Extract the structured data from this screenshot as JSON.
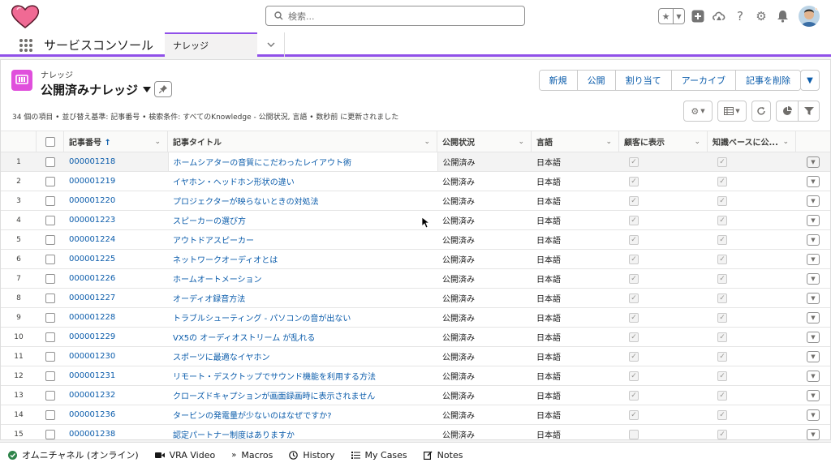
{
  "header": {
    "search_placeholder": "検索...",
    "app_name": "サービスコンソール",
    "tab_label": "ナレッジ"
  },
  "list": {
    "object_label": "ナレッジ",
    "list_name": "公開済みナレッジ",
    "status_text": "34 個の項目 • 並び替え基準: 記事番号 • 検索条件: すべてのKnowledge - 公開状況, 言語 • 数秒前 に更新されました",
    "actions": [
      "新規",
      "公開",
      "割り当て",
      "アーカイブ",
      "記事を削除"
    ]
  },
  "columns": {
    "article_number": "記事番号",
    "title": "記事タイトル",
    "publish_status": "公開状況",
    "language": "言語",
    "visible_to_customer": "顧客に表示",
    "knowledge_base": "知識ベースに公..."
  },
  "rows": [
    {
      "n": "1",
      "id": "000001218",
      "title": "ホームシアターの音質にこだわったレイアウト術",
      "status": "公開済み",
      "lang": "日本語",
      "customer": true
    },
    {
      "n": "2",
      "id": "000001219",
      "title": "イヤホン・ヘッドホン形状の違い",
      "status": "公開済み",
      "lang": "日本語",
      "customer": true
    },
    {
      "n": "3",
      "id": "000001220",
      "title": "プロジェクターが映らないときの対処法",
      "status": "公開済み",
      "lang": "日本語",
      "customer": true
    },
    {
      "n": "4",
      "id": "000001223",
      "title": "スピーカーの選び方",
      "status": "公開済み",
      "lang": "日本語",
      "customer": true
    },
    {
      "n": "5",
      "id": "000001224",
      "title": "アウトドアスピーカー",
      "status": "公開済み",
      "lang": "日本語",
      "customer": true
    },
    {
      "n": "6",
      "id": "000001225",
      "title": "ネットワークオーディオとは",
      "status": "公開済み",
      "lang": "日本語",
      "customer": true
    },
    {
      "n": "7",
      "id": "000001226",
      "title": "ホームオートメーション",
      "status": "公開済み",
      "lang": "日本語",
      "customer": true
    },
    {
      "n": "8",
      "id": "000001227",
      "title": "オーディオ録音方法",
      "status": "公開済み",
      "lang": "日本語",
      "customer": true
    },
    {
      "n": "9",
      "id": "000001228",
      "title": "トラブルシューティング - パソコンの音が出ない",
      "status": "公開済み",
      "lang": "日本語",
      "customer": true
    },
    {
      "n": "10",
      "id": "000001229",
      "title": "VX5の オーディオストリーム が乱れる",
      "status": "公開済み",
      "lang": "日本語",
      "customer": true
    },
    {
      "n": "11",
      "id": "000001230",
      "title": "スポーツに最適なイヤホン",
      "status": "公開済み",
      "lang": "日本語",
      "customer": true
    },
    {
      "n": "12",
      "id": "000001231",
      "title": "リモート・デスクトップでサウンド機能を利用する方法",
      "status": "公開済み",
      "lang": "日本語",
      "customer": true
    },
    {
      "n": "13",
      "id": "000001232",
      "title": "クローズドキャプションが画面録画時に表示されません",
      "status": "公開済み",
      "lang": "日本語",
      "customer": true
    },
    {
      "n": "14",
      "id": "000001236",
      "title": "タービンの発電量が少ないのはなぜですか?",
      "status": "公開済み",
      "lang": "日本語",
      "customer": true
    },
    {
      "n": "15",
      "id": "000001238",
      "title": "認定パートナー制度はありますか",
      "status": "公開済み",
      "lang": "日本語",
      "customer": false
    }
  ],
  "utility_bar": {
    "omni": "オムニチャネル (オンライン)",
    "vra": "VRA Video",
    "macros": "Macros",
    "history": "History",
    "my_cases": "My Cases",
    "notes": "Notes"
  },
  "colors": {
    "accent": "#9050e9",
    "link": "#0b5cab",
    "object_icon": "#e04fdc",
    "online": "#2e844a"
  }
}
